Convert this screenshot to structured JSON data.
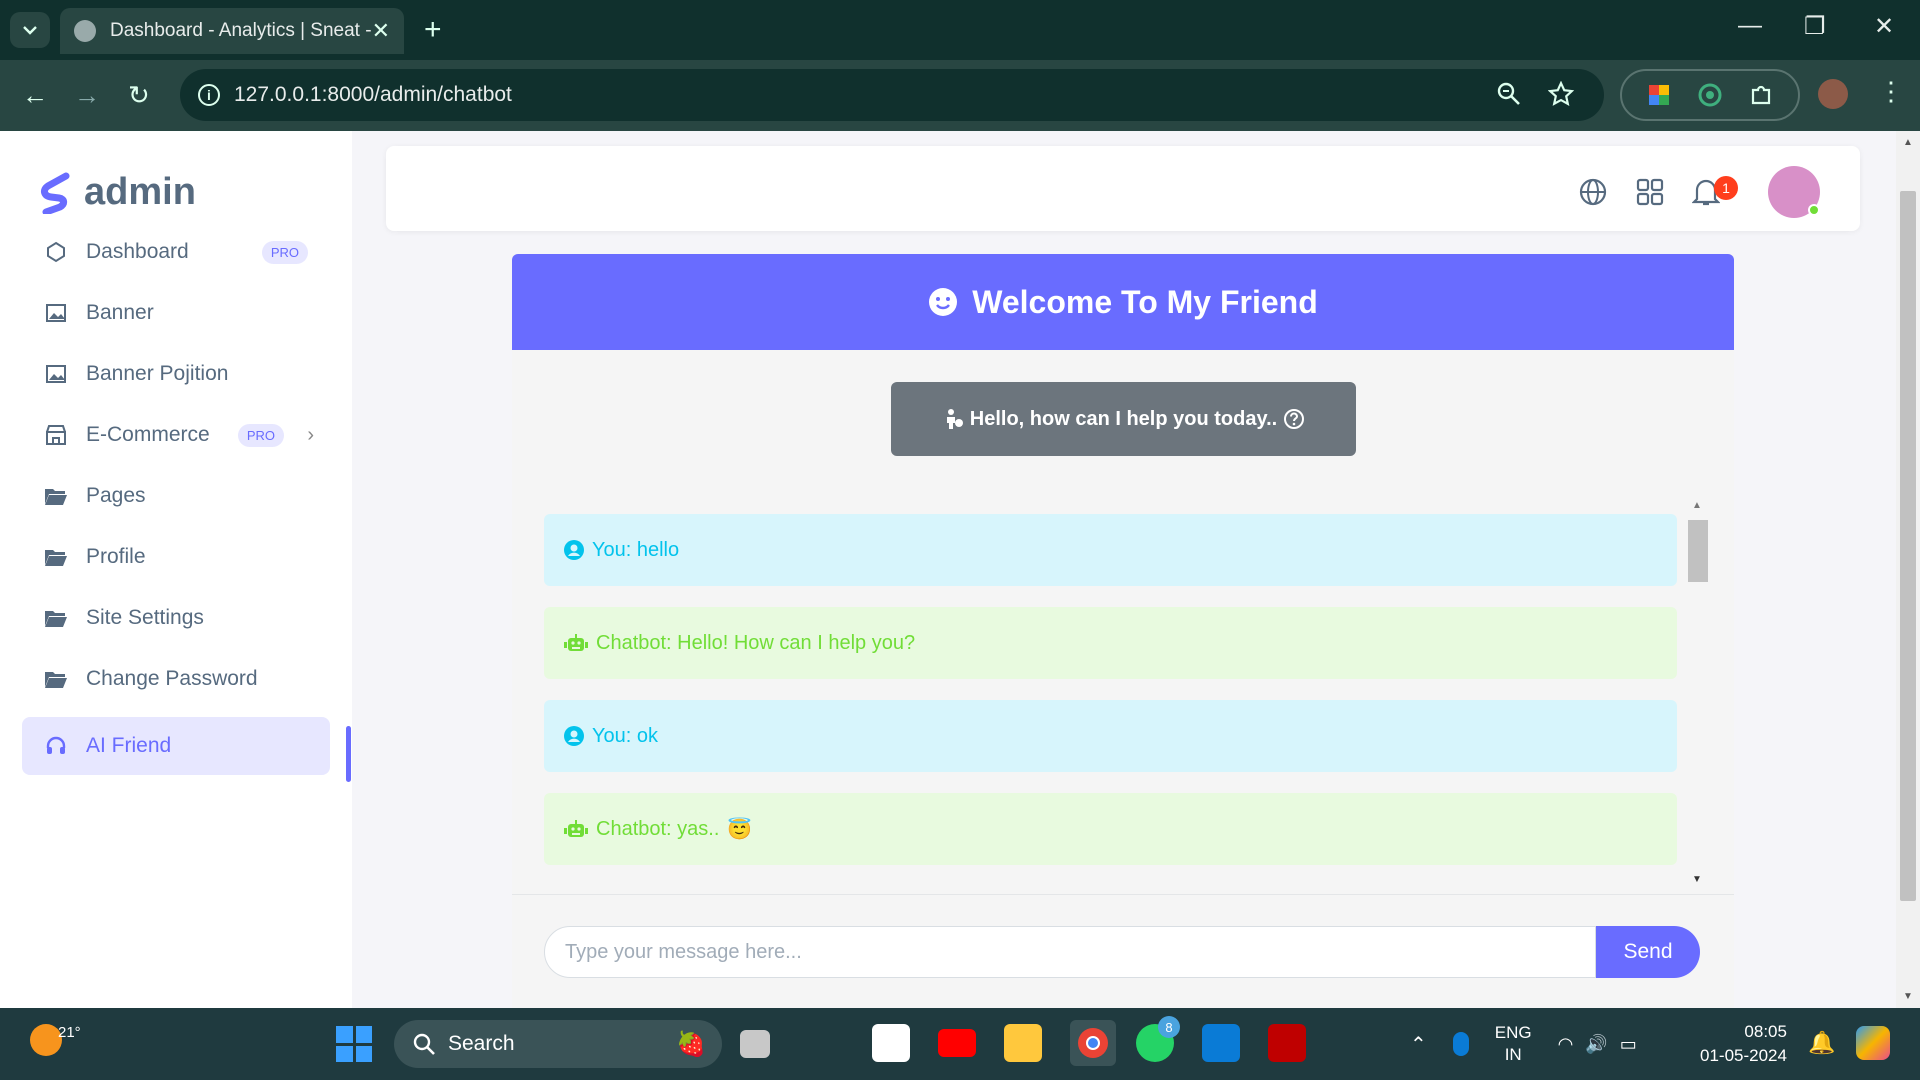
{
  "browser": {
    "tab_title": "Dashboard - Analytics | Sneat -",
    "url": "127.0.0.1:8000/admin/chatbot"
  },
  "sidebar": {
    "brand": "admin",
    "items": [
      {
        "label": "Dashboard",
        "badge": "PRO"
      },
      {
        "label": "Banner"
      },
      {
        "label": "Banner Pojition"
      },
      {
        "label": "E-Commerce",
        "badge": "PRO"
      },
      {
        "label": "Pages"
      },
      {
        "label": "Profile"
      },
      {
        "label": "Site Settings"
      },
      {
        "label": "Change Password"
      },
      {
        "label": "AI Friend"
      }
    ],
    "active_item": "AI Friend"
  },
  "navbar": {
    "notification_count": "1"
  },
  "chat": {
    "header": "Welcome To My Friend",
    "greeting_button": "Hello, how can I help you today..",
    "messages": [
      {
        "role": "user",
        "text": "You: hello"
      },
      {
        "role": "bot",
        "text": "Chatbot: Hello! How can I help you?"
      },
      {
        "role": "user",
        "text": "You: ok"
      },
      {
        "role": "bot",
        "text": "Chatbot: yas..",
        "emoji": "😇"
      }
    ],
    "input_placeholder": "Type your message here...",
    "send_label": "Send"
  },
  "taskbar": {
    "temperature": "21°",
    "search_label": "Search",
    "whatsapp_badge": "8",
    "language": "ENG",
    "region": "IN",
    "time": "08:05",
    "date": "01-05-2024"
  },
  "colors": {
    "primary": "#696cff",
    "info": "#03c3ec",
    "success": "#71dd37",
    "secondary": "#6c757d",
    "danger": "#ff3e1d"
  }
}
